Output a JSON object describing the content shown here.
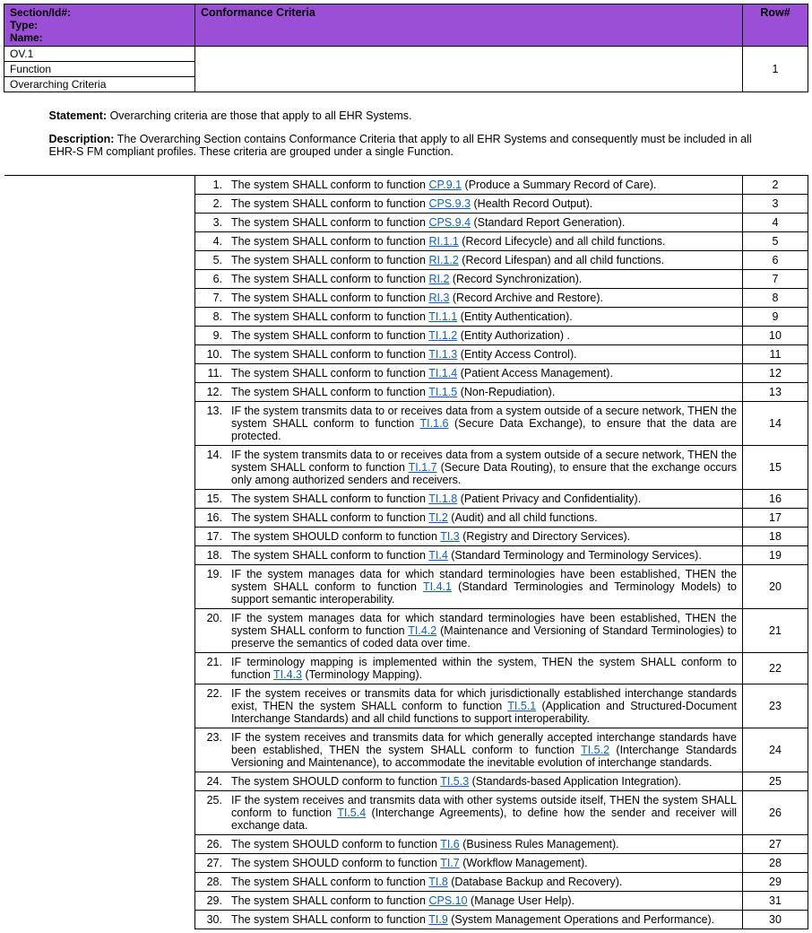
{
  "header": {
    "labelLines": "Section/Id#:\nType:\nName:",
    "crit": "Conformance Criteria",
    "row": "Row#"
  },
  "section": {
    "id": "OV.1",
    "type": "Function",
    "name": "Overarching Criteria",
    "row": "1"
  },
  "statement": {
    "l1": "Statement:",
    "t1": " Overarching criteria are those that apply to all EHR Systems.",
    "l2": "Description:",
    "t2": " The Overarching Section contains Conformance Criteria that apply to all EHR Systems and consequently must be included in all EHR-S FM compliant profiles. These criteria are grouped under a single Function."
  },
  "criteria": [
    {
      "n": "1.",
      "pre": "The system SHALL conform to function ",
      "link": "CP.9.1",
      "post": " (Produce a Summary Record of Care).",
      "row": "2"
    },
    {
      "n": "2.",
      "pre": "The system SHALL conform to function ",
      "link": "CPS.9.3",
      "post": " (Health Record Output).",
      "row": "3"
    },
    {
      "n": "3.",
      "pre": "The system SHALL conform to function ",
      "link": "CPS.9.4",
      "post": " (Standard Report Generation).",
      "row": "4"
    },
    {
      "n": "4.",
      "pre": "The system SHALL conform to function ",
      "link": "RI.1.1",
      "post": " (Record Lifecycle) and all child functions.",
      "row": "5"
    },
    {
      "n": "5.",
      "pre": "The system SHALL conform to function ",
      "link": "RI.1.2",
      "post": " (Record Lifespan) and all child functions.",
      "row": "6"
    },
    {
      "n": "6.",
      "pre": "The system SHALL conform to function ",
      "link": "RI.2",
      "post": " (Record Synchronization).",
      "row": "7"
    },
    {
      "n": "7.",
      "pre": "The system SHALL conform to function ",
      "link": "RI.3",
      "post": " (Record Archive and Restore).",
      "row": "8"
    },
    {
      "n": "8.",
      "pre": "The system SHALL conform to function ",
      "link": "TI.1.1",
      "post": " (Entity Authentication).",
      "row": "9"
    },
    {
      "n": "9.",
      "pre": "The system SHALL conform to function ",
      "link": "TI.1.2",
      "post": " (Entity Authorization) .",
      "row": "10"
    },
    {
      "n": "10.",
      "pre": "The system SHALL conform to function ",
      "link": "TI.1.3",
      "post": " (Entity Access Control).",
      "row": "11"
    },
    {
      "n": "11.",
      "pre": "The system SHALL conform to function ",
      "link": "TI.1.4",
      "post": " (Patient Access Management).",
      "row": "12"
    },
    {
      "n": "12.",
      "pre": "The system SHALL conform to function ",
      "link": "TI.1.5",
      "post": " (Non-Repudiation).",
      "row": "13"
    },
    {
      "n": "13.",
      "pre": "IF the system transmits data to or receives data from a system outside of a secure network, THEN the system SHALL conform to function ",
      "link": "TI.1.6",
      "post": " (Secure Data Exchange), to ensure that the data are protected.",
      "row": "14"
    },
    {
      "n": "14.",
      "pre": "IF the system transmits data to or receives data from a system outside of a secure network, THEN the system SHALL conform to function ",
      "link": "TI.1.7",
      "post": " (Secure Data Routing), to ensure that the exchange occurs only among authorized senders and receivers.",
      "row": "15"
    },
    {
      "n": "15.",
      "pre": "The system SHALL conform to function ",
      "link": "TI.1.8",
      "post": " (Patient Privacy and Confidentiality).",
      "row": "16"
    },
    {
      "n": "16.",
      "pre": "The system SHALL conform to function ",
      "link": "TI.2",
      "post": " (Audit) and all child functions.",
      "row": "17"
    },
    {
      "n": "17.",
      "pre": "The system SHOULD conform to function ",
      "link": "TI.3",
      "post": " (Registry and Directory Services).",
      "row": "18"
    },
    {
      "n": "18.",
      "pre": "The system SHALL conform to function ",
      "link": "TI.4",
      "post": " (Standard Terminology and Terminology Services).",
      "row": "19"
    },
    {
      "n": "19.",
      "pre": "IF the system manages data for which standard terminologies have been established, THEN the system SHALL conform to function ",
      "link": "TI.4.1",
      "post": " (Standard Terminologies and Terminology Models) to support semantic interoperability.",
      "row": "20"
    },
    {
      "n": "20.",
      "pre": "IF the system manages data for which standard terminologies have been established, THEN the system SHALL conform to function ",
      "link": "TI.4.2",
      "post": " (Maintenance and Versioning of Standard Terminologies) to preserve the semantics of coded data over time.",
      "row": "21"
    },
    {
      "n": "21.",
      "pre": "IF terminology mapping is implemented within the system, THEN the system SHALL conform to function ",
      "link": "TI.4.3",
      "post": " (Terminology Mapping).",
      "row": "22"
    },
    {
      "n": "22.",
      "pre": "IF the system receives or transmits data for which jurisdictionally established interchange standards exist, THEN the system SHALL conform to function ",
      "link": "TI.5.1",
      "post": " (Application and Structured-Document Interchange Standards) and all child functions to support interoperability.",
      "row": "23"
    },
    {
      "n": "23.",
      "pre": "IF the system receives and transmits data for which generally accepted interchange standards have been established, THEN the system SHALL conform to function ",
      "link": "TI.5.2",
      "post": " (Interchange Standards Versioning and Maintenance), to accommodate the inevitable evolution of interchange standards.",
      "row": "24"
    },
    {
      "n": "24.",
      "pre": "The system SHOULD conform to function ",
      "link": "TI.5.3",
      "post": " (Standards-based Application Integration).",
      "row": "25"
    },
    {
      "n": "25.",
      "pre": "IF the system receives and transmits data with other systems outside itself, THEN the system SHALL conform to function ",
      "link": "TI.5.4",
      "post": " (Interchange Agreements), to define how the sender and receiver will exchange data.",
      "row": "26"
    },
    {
      "n": "26.",
      "pre": "The system SHOULD conform to function ",
      "link": "TI.6",
      "post": " (Business Rules Management).",
      "row": "27"
    },
    {
      "n": "27.",
      "pre": "The system SHOULD conform to function ",
      "link": "TI.7",
      "post": " (Workflow Management).",
      "row": "28"
    },
    {
      "n": "28.",
      "pre": "The system SHALL conform to function ",
      "link": "TI.8",
      "post": " (Database Backup and Recovery).",
      "row": "29"
    },
    {
      "n": "29.",
      "pre": "The system SHALL conform to function ",
      "link": "CPS.10",
      "post": " (Manage User Help).",
      "row": "31"
    },
    {
      "n": "30.",
      "pre": "The system SHALL conform to function ",
      "link": "TI.9",
      "post": " (System Management Operations and Performance).",
      "row": "30"
    }
  ]
}
